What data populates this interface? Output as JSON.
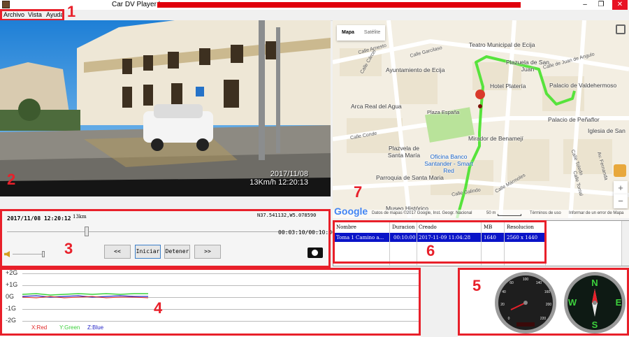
{
  "window": {
    "title": "Car DV Player |",
    "min": "–",
    "restore": "❐",
    "close": "✕"
  },
  "menu": [
    "Archivo",
    "Vista",
    "Ayuda"
  ],
  "annotations": [
    "1",
    "2",
    "3",
    "4",
    "5",
    "6",
    "7"
  ],
  "video": {
    "date": "2017/11/08",
    "speed_time": "13Km/h 12:20:13"
  },
  "controls": {
    "datetime": "2017/11/08 12:20:12",
    "distance": "13km",
    "coords": "N37.541132,W5.078590",
    "time": "00:03:10/00:10:00",
    "progress": 0.317,
    "buttons": {
      "prev": "<<",
      "start": "Iniciar",
      "stop": "Detener",
      "next": ">>"
    }
  },
  "map": {
    "tabs": [
      "Mapa",
      "Satélite"
    ],
    "places": [
      "Teatro Municipal de Ecija",
      "Ayuntamiento de Ecija",
      "Plazuela de San Juan",
      "Hotel Platería",
      "Palacio de Valdehermoso",
      "Arca Real del Agua",
      "Plaza España",
      "Mirador de Benamejí",
      "Palacio de Peñaflor",
      "Iglesia de San",
      "Plazvela de Santa María",
      "Oficina Banco Santander - Smart Red",
      "Parroquia de Santa Maria",
      "Museo Histórico"
    ],
    "streets": [
      "Calle Arnesto",
      "Calle Cárcel",
      "Calle Garcilaso",
      "Calle de Juan de Angulo",
      "Calle Conde",
      "Calle Galindo",
      "Calle Mármoles",
      "Calle Toledo",
      "Av. Fernanda",
      "Calle Tornal"
    ],
    "footer": {
      "google": "Google",
      "data": "Datos de mapas ©2017 Google, Inst. Geogr. Nacional",
      "scale": "50 m",
      "terms": "Términos de uso",
      "report": "Informar de un error de Mapa"
    },
    "zoom_in": "+",
    "zoom_out": "−"
  },
  "table": {
    "headers": [
      "Nombre",
      "Duracion",
      "Creado",
      "MB",
      "Resolucion"
    ],
    "row": [
      "Toma 1 Camino a...",
      "00:10:00",
      "2017-11-09 11:04:28",
      "1640",
      "2560 x 1440"
    ]
  },
  "graph": {
    "ylabels": [
      "+2G",
      "+1G",
      "0G",
      "-1G",
      "-2G"
    ],
    "legend": [
      "X:Red",
      "Y:Green",
      "Z:Blue"
    ]
  },
  "colors": {
    "accent_red": "#e8202a",
    "select_blue": "#0a14c8",
    "route_green": "#57e33c"
  }
}
